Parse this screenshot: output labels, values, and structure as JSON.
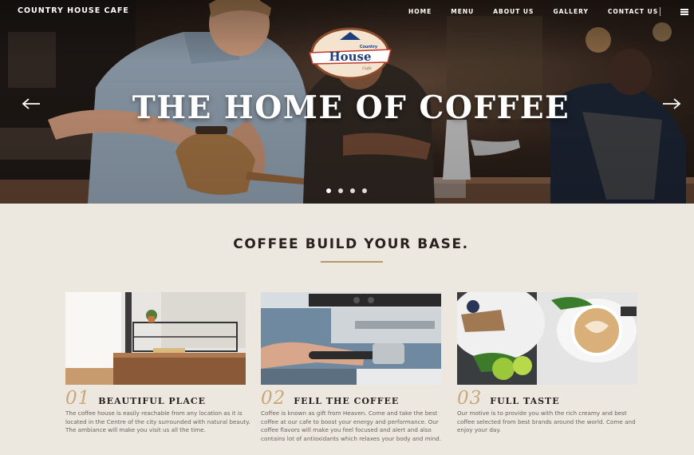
{
  "header": {
    "brand": "COUNTRY HOUSE CAFE",
    "nav": [
      "HOME",
      "MENU",
      "ABOUT US",
      "GALLERY",
      "CONTACT US"
    ],
    "menu_icon": "hamburger-icon"
  },
  "hero": {
    "logo": {
      "main": "House",
      "top": "Country",
      "sub": "Cafe"
    },
    "title": "THE HOME OF COFFEE",
    "prev_icon": "arrow-left-icon",
    "next_icon": "arrow-right-icon",
    "slides": 4,
    "active_slide": 1
  },
  "section": {
    "title": "COFFEE BUILD YOUR BASE."
  },
  "features": [
    {
      "num": "01",
      "title": "BEAUTIFUL PLACE",
      "desc": "The coffee house is easily reachable from any location as it is located in the Centre of the city surrounded with natural beauty. The ambiance will make you visit us all the time."
    },
    {
      "num": "02",
      "title": "FELL THE COFFEE",
      "desc": "Coffee is known as gift from Heaven. Come and take the best coffee at our cafe to boost your energy and performance. Our coffee flavors will make you feel focused and alert and also contains lot of antioxidants which relaxes your body and mind."
    },
    {
      "num": "03",
      "title": "FULL TASTE",
      "desc": "Our motive is to provide you with the rich creamy and best coffee selected from best brands around the world. Come and enjoy your day."
    }
  ],
  "colors": {
    "page_bg": "#ece7df",
    "accent": "#c8a77a",
    "heading": "#2a211c",
    "body_text": "#6b625c"
  }
}
